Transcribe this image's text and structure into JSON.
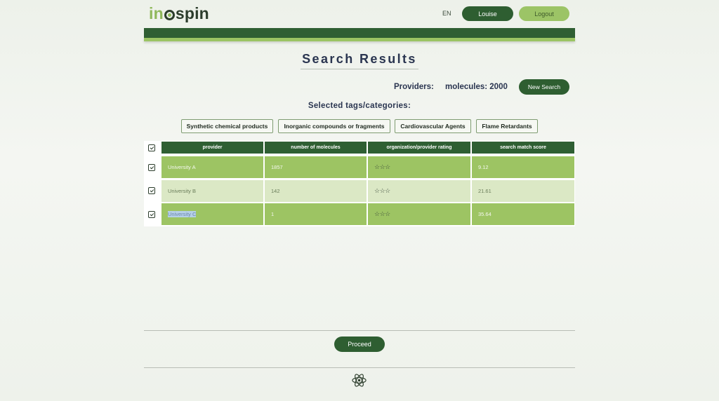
{
  "header": {
    "logo_prefix": "in",
    "logo_suffix": "spin",
    "language": "EN",
    "user_label": "Louise",
    "logout_label": "Logout"
  },
  "page_title": "Search Results",
  "summary": {
    "providers_label": "Providers:",
    "molecules_label": "molecules: 2000",
    "new_search_label": "New Search"
  },
  "tags": {
    "heading": "Selected tags/categories:",
    "items": [
      "Synthetic chemical products",
      "Inorganic compounds or fragments",
      "Cardiovascular Agents",
      "Flame Retardants"
    ]
  },
  "table": {
    "columns": [
      "provider",
      "number of molecules",
      "organization/provider rating",
      "search match score"
    ],
    "rows": [
      {
        "provider": "University A",
        "molecules": "1857",
        "rating": "☆☆☆",
        "score": "9.12",
        "checked": true
      },
      {
        "provider": "University B",
        "molecules": "142",
        "rating": "☆☆☆",
        "score": "21.61",
        "checked": true
      },
      {
        "provider": "University C",
        "molecules": "1",
        "rating": "☆☆☆",
        "score": "35.64",
        "checked": true
      }
    ],
    "select_all_checked": true
  },
  "footer": {
    "proceed_label": "Proceed",
    "icon": "atom-icon"
  },
  "colors": {
    "primary_dark": "#2e5e31",
    "accent_light": "#9cc466",
    "row_light": "#dbe8c5",
    "title_text": "#2a3550"
  }
}
